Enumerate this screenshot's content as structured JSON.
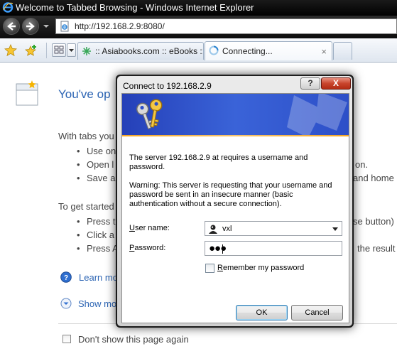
{
  "window": {
    "title": "Welcome to Tabbed Browsing - Windows Internet Explorer"
  },
  "address_bar": {
    "url": "http://192.168.2.9:8080/"
  },
  "tabs": [
    {
      "label": ":: Asiabooks.com :: eBooks ::"
    },
    {
      "label": "Connecting...",
      "close": "×"
    }
  ],
  "page": {
    "heading": "You've op",
    "tabs_intro": "With tabs you",
    "bullets_1": [
      {
        "left": "Use on",
        "right": ""
      },
      {
        "left": "Open l",
        "right": "on."
      },
      {
        "left": "Save a",
        "right": "and home"
      }
    ],
    "get_started": "To get started",
    "bullets_2": [
      {
        "left": "Press t",
        "right": "se button)"
      },
      {
        "left": "Click a",
        "right": ""
      },
      {
        "left": "Press A",
        "right": "the result"
      }
    ],
    "learn_more": "Learn mo",
    "show_more": "Show mo",
    "dont_show": "Don't show this page again"
  },
  "dialog": {
    "title": "Connect to 192.168.2.9",
    "help": "?",
    "close": "X",
    "message": "The server 192.168.2.9 at  requires a username and password.",
    "warning": "Warning: This server is requesting that your username and password be sent in an insecure manner (basic authentication without a secure connection).",
    "username_label_u": "U",
    "username_label_rest": "ser name:",
    "username_value": "vxl",
    "password_label_u": "P",
    "password_label_rest": "assword:",
    "password_mask": "●●●",
    "remember_u": "R",
    "remember_rest": "emember my password",
    "remember_checked": false,
    "ok": "OK",
    "cancel": "Cancel"
  },
  "colors": {
    "link_blue": "#2d65b4",
    "banner_blue": "#2d4fc8",
    "close_red": "#c8442c"
  }
}
